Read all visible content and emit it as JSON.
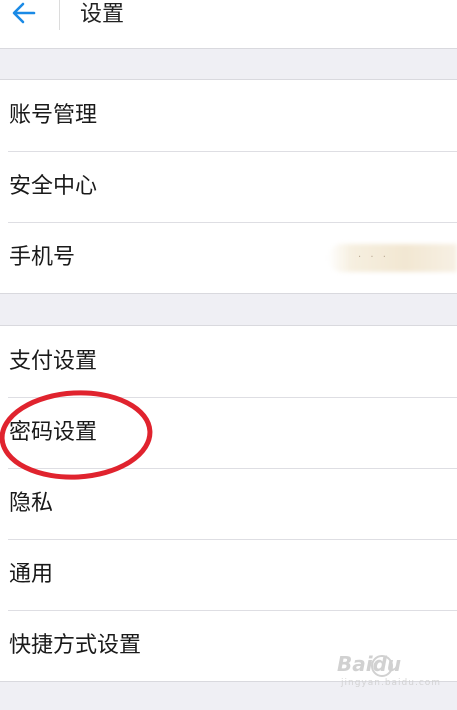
{
  "header": {
    "title": "设置",
    "back_icon": "arrow-left-icon",
    "accent_color": "#1a8ae6"
  },
  "group1": {
    "items": [
      {
        "label": "账号管理"
      },
      {
        "label": "安全中心"
      },
      {
        "label": "手机号"
      }
    ]
  },
  "group2": {
    "items": [
      {
        "label": "支付设置"
      },
      {
        "label": "密码设置"
      },
      {
        "label": "隐私"
      },
      {
        "label": "通用"
      },
      {
        "label": "快捷方式设置"
      }
    ]
  },
  "annotation": {
    "color": "#e0232e"
  },
  "watermark": {
    "logo": "Baidu",
    "sub": "jingyan.baidu.com"
  }
}
